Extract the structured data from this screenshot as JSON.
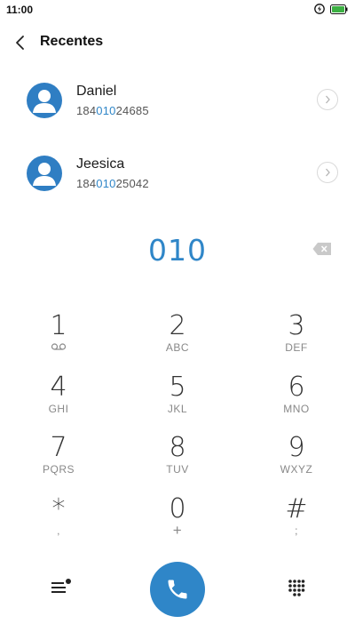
{
  "status_bar": {
    "time": "11:00"
  },
  "header": {
    "title": "Recentes"
  },
  "contacts": [
    {
      "name": "Daniel",
      "number_prefix": "184",
      "number_match": "010",
      "number_suffix": "24685"
    },
    {
      "name": "Jeesica",
      "number_prefix": "184",
      "number_match": "010",
      "number_suffix": "25042"
    }
  ],
  "dialer": {
    "entered": "010",
    "keys": [
      {
        "digit": "1",
        "letters": ""
      },
      {
        "digit": "2",
        "letters": "ABC"
      },
      {
        "digit": "3",
        "letters": "DEF"
      },
      {
        "digit": "4",
        "letters": "GHI"
      },
      {
        "digit": "5",
        "letters": "JKL"
      },
      {
        "digit": "6",
        "letters": "MNO"
      },
      {
        "digit": "7",
        "letters": "PQRS"
      },
      {
        "digit": "8",
        "letters": "TUV"
      },
      {
        "digit": "9",
        "letters": "WXYZ"
      },
      {
        "digit": "*",
        "letters": ","
      },
      {
        "digit": "0",
        "letters": "+"
      },
      {
        "digit": "#",
        "letters": ";"
      }
    ]
  },
  "colors": {
    "accent": "#2f86c8",
    "avatar": "#2f7ec3"
  },
  "icons": [
    "back-icon",
    "voicemail-icon",
    "backspace-icon",
    "menu-icon",
    "phone-icon",
    "keypad-icon",
    "chevron-right-icon",
    "person-icon"
  ]
}
